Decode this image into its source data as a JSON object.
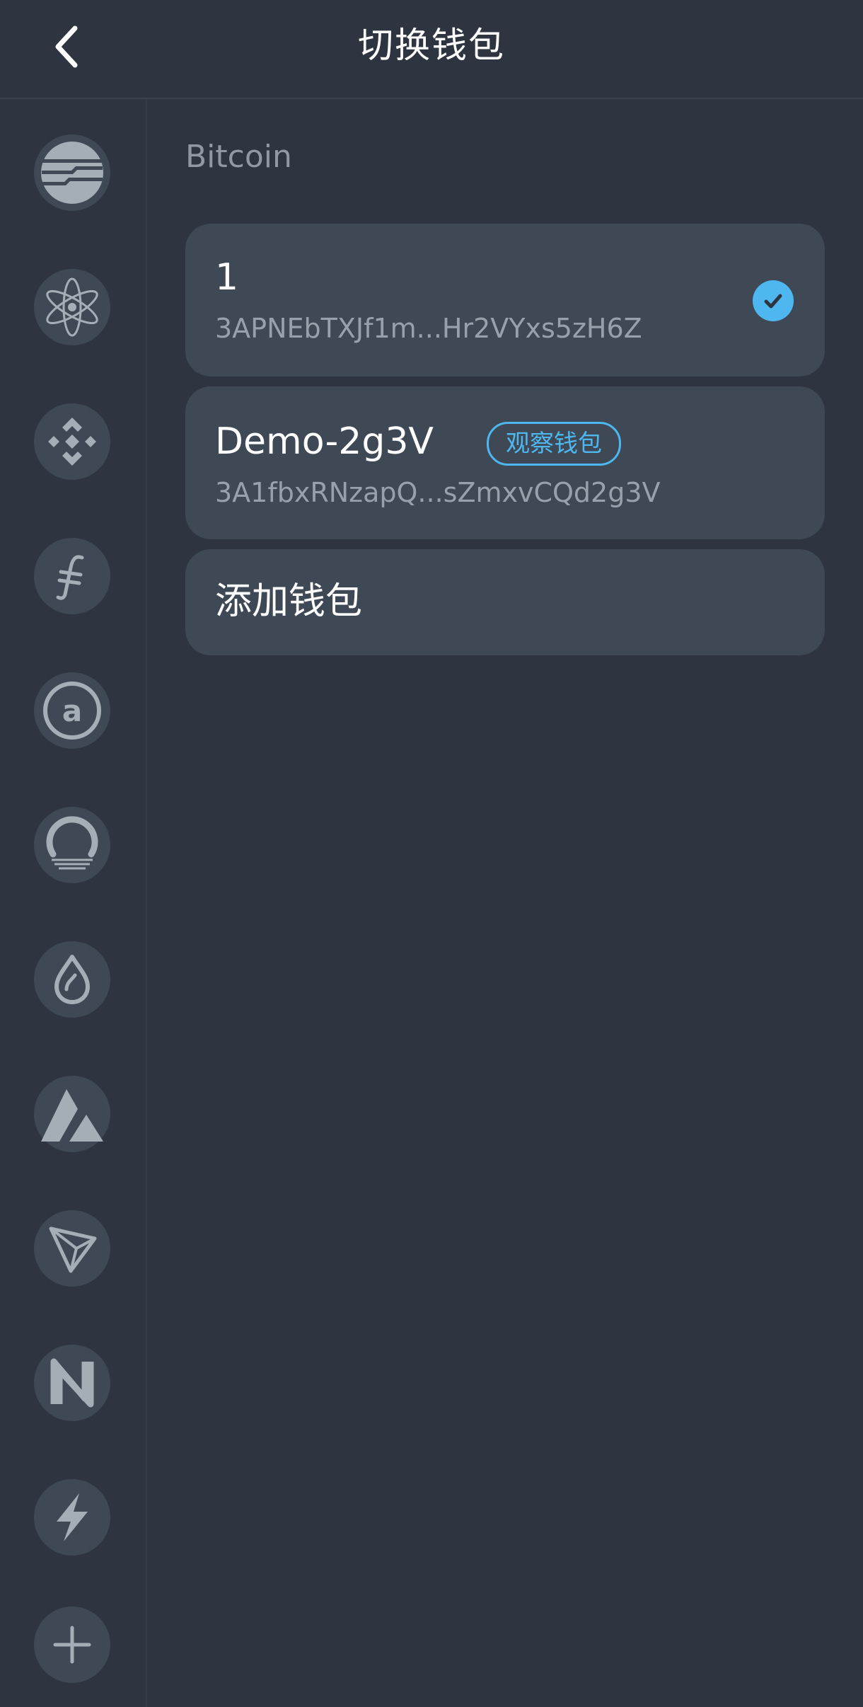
{
  "header": {
    "title": "切换钱包",
    "back_icon": "chevron-left-icon"
  },
  "sidebar": {
    "items": [
      {
        "name": "aptos",
        "icon": "aptos-icon"
      },
      {
        "name": "cosmos",
        "icon": "cosmos-atom-icon"
      },
      {
        "name": "bnb",
        "icon": "bnb-icon"
      },
      {
        "name": "filecoin",
        "icon": "filecoin-icon"
      },
      {
        "name": "algorand",
        "icon": "algorand-a-icon"
      },
      {
        "name": "ontology",
        "icon": "ring-icon"
      },
      {
        "name": "sui",
        "icon": "water-drop-icon"
      },
      {
        "name": "avalanche",
        "icon": "avalanche-icon"
      },
      {
        "name": "tron",
        "icon": "tron-icon"
      },
      {
        "name": "near",
        "icon": "near-icon"
      },
      {
        "name": "lightning",
        "icon": "lightning-icon"
      }
    ],
    "add_icon": "plus-icon"
  },
  "main": {
    "section_title": "Bitcoin",
    "wallets": [
      {
        "name": "1",
        "address": "3APNEbTXJf1m...Hr2VYxs5zH6Z",
        "selected": true
      },
      {
        "name": "Demo-2g3V",
        "address": "3A1fbxRNzapQ...sZmxvCQd2g3V",
        "badge": "观察钱包",
        "selected": false
      }
    ],
    "add_wallet_label": "添加钱包"
  },
  "colors": {
    "background": "#2e3540",
    "card": "#3e4955",
    "accent": "#4eb7ef",
    "muted_text": "#98a1ab",
    "icon_gray": "#a5adb6"
  }
}
